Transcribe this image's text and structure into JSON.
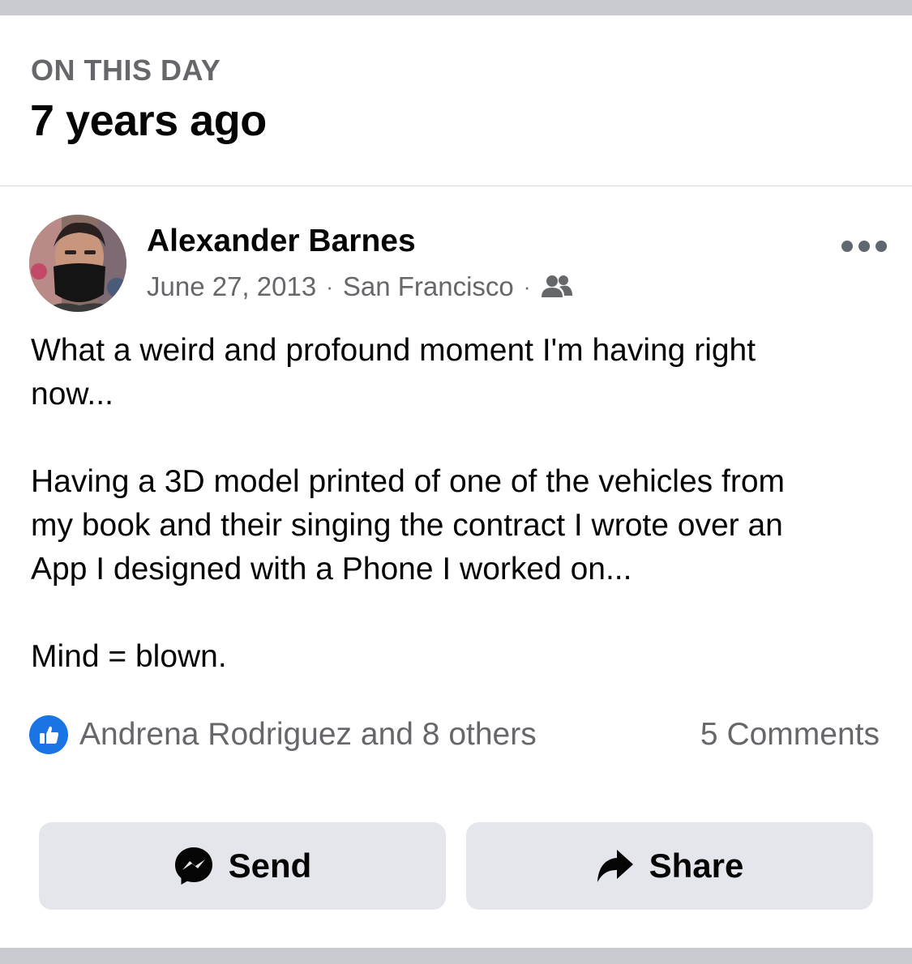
{
  "memory": {
    "label": "ON THIS DAY",
    "title": "7 years ago"
  },
  "post": {
    "author": "Alexander Barnes",
    "date": "June 27, 2013",
    "separator": "·",
    "location": "San Francisco",
    "audience_icon": "friends-icon",
    "more_icon": "more-options-icon",
    "paragraphs": [
      [
        "What a weird and profound moment I'm having right",
        "now..."
      ],
      [
        "Having a 3D model printed of one of the vehicles from",
        "my book and their singing the contract I wrote over an",
        "App I designed with a Phone I worked on..."
      ],
      [
        "Mind = blown."
      ]
    ]
  },
  "engagement": {
    "reaction_icon": "like-icon",
    "reactions_text": "Andrena Rodriguez and 8 others",
    "comments_text": "5 Comments"
  },
  "actions": {
    "send_label": "Send",
    "send_icon": "messenger-icon",
    "share_label": "Share",
    "share_icon": "share-arrow-icon"
  },
  "colors": {
    "accent": "#1b74e4",
    "secondary_text": "#65676b",
    "button_bg": "#e4e6eb",
    "frame_bar": "#c9cbd0"
  }
}
